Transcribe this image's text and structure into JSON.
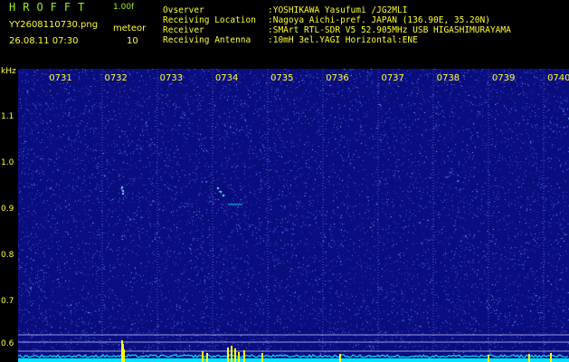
{
  "header": {
    "title": "HROFFT",
    "version": "1.00f",
    "filename": "YY2608110730.png",
    "datetime": "26.08.11 07:30",
    "meteor_label": "meteor",
    "meteor_count": "10",
    "info": [
      {
        "key": "Ovserver",
        "value": ":YOSHIKAWA Yasufumi /JG2MLI"
      },
      {
        "key": "Receiving Location",
        "value": ":Nagoya Aichi-pref. JAPAN (136.90E, 35.20N)"
      },
      {
        "key": "Receiver",
        "value": ":SMArt RTL-SDR V5 52.905MHz USB HIGASHIMURAYAMA"
      },
      {
        "key": "Receiving Antenna",
        "value": ":10mH 3el.YAGI Horizontal:ENE"
      }
    ]
  },
  "spectrogram": {
    "y_unit": "kHz",
    "y_ticks": [
      "1.1",
      "1.0",
      "0.9",
      "0.8",
      "0.7",
      "0.6"
    ],
    "time_ticks": [
      "0731",
      "0732",
      "0733",
      "0734",
      "0735",
      "0736",
      "0737",
      "0738",
      "0739",
      "0740"
    ],
    "colors": {
      "background": "#0a0d7e",
      "noise": "#4a7bff",
      "echo": "#7fe8ff",
      "trace": "#00e5ff",
      "peak": "#ffff00",
      "label": "#ffff33"
    }
  }
}
